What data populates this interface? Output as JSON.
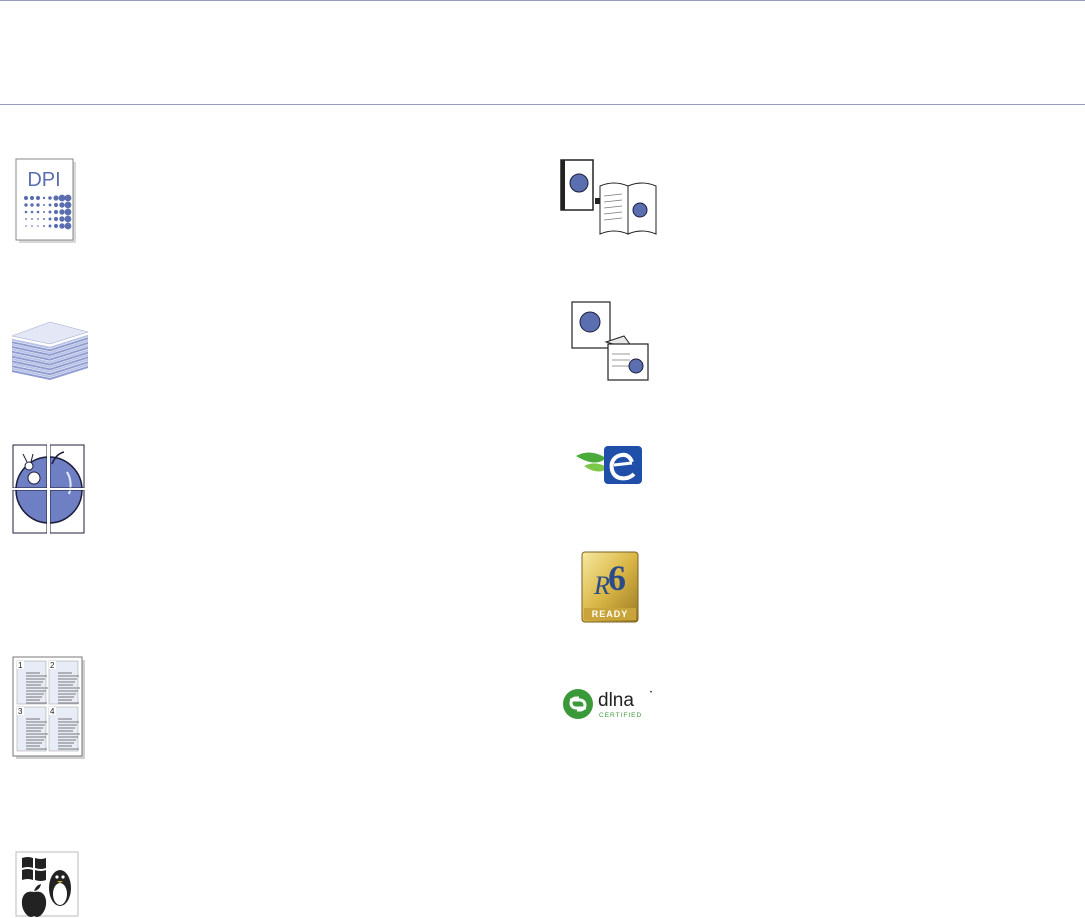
{
  "page": {
    "accent_color": "#5b6fb0",
    "rule_color": "#9a9ac0"
  },
  "features_left": [
    {
      "icon": "dpi-resolution-icon",
      "label": "DPI"
    },
    {
      "icon": "paper-stack-icon"
    },
    {
      "icon": "poster-tiles-icon"
    },
    {
      "icon": "multiple-pages-per-sheet-icon",
      "page_numbers": [
        "1",
        "2",
        "3",
        "4"
      ]
    },
    {
      "icon": "os-compatibility-icon"
    }
  ],
  "features_right": [
    {
      "icon": "booklet-print-icon"
    },
    {
      "icon": "watermark-overlay-icon"
    },
    {
      "icon": "eco-logo-icon"
    },
    {
      "icon": "ipv6-ready-logo-icon",
      "label": "READY"
    },
    {
      "icon": "dlna-certified-logo-icon",
      "label": "dlna",
      "sublabel": "CERTIFIED"
    }
  ]
}
